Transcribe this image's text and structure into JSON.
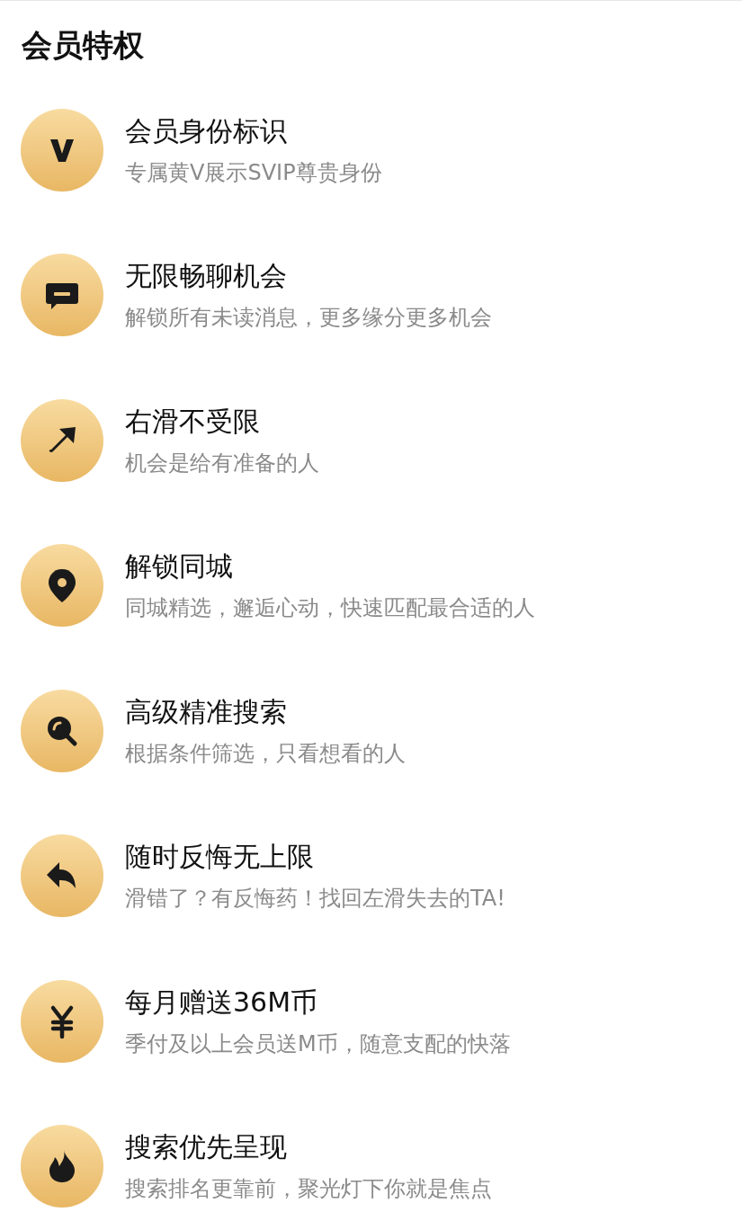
{
  "title": "会员特权",
  "items": [
    {
      "kind": "v-badge",
      "title": "会员身份标识",
      "subtitle": "专属黄V展示SVIP尊贵身份"
    },
    {
      "kind": "chat",
      "title": "无限畅聊机会",
      "subtitle": "解锁所有未读消息，更多缘分更多机会"
    },
    {
      "kind": "arrow",
      "title": "右滑不受限",
      "subtitle": "机会是给有准备的人"
    },
    {
      "kind": "pin",
      "title": "解锁同城",
      "subtitle": "同城精选，邂逅心动，快速匹配最合适的人"
    },
    {
      "kind": "search",
      "title": "高级精准搜索",
      "subtitle": "根据条件筛选，只看想看的人"
    },
    {
      "kind": "undo",
      "title": "随时反悔无上限",
      "subtitle": "滑错了？有反悔药！找回左滑失去的TA!"
    },
    {
      "kind": "yen",
      "title": "每月赠送36M币",
      "subtitle": "季付及以上会员送M币，随意支配的快落"
    },
    {
      "kind": "fire",
      "title": "搜索优先呈现",
      "subtitle": "搜索排名更靠前，聚光灯下你就是焦点"
    }
  ]
}
